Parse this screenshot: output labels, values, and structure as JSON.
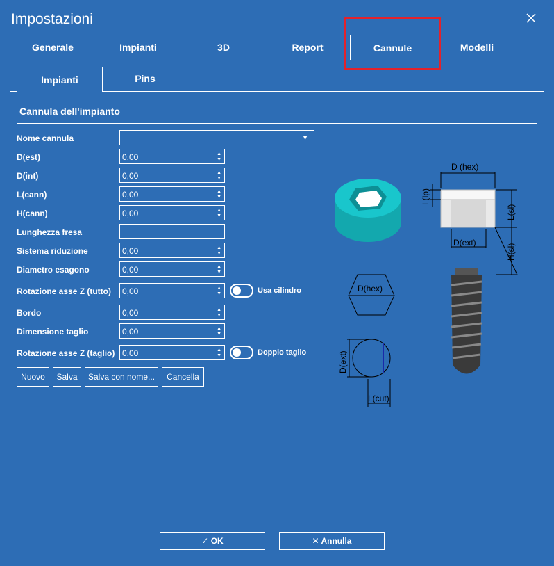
{
  "window": {
    "title": "Impostazioni"
  },
  "tabs": [
    {
      "label": "Generale"
    },
    {
      "label": "Impianti"
    },
    {
      "label": "3D"
    },
    {
      "label": "Report"
    },
    {
      "label": "Cannule"
    },
    {
      "label": "Modelli"
    }
  ],
  "subtabs": [
    {
      "label": "Impianti"
    },
    {
      "label": "Pins"
    }
  ],
  "section": {
    "title": "Cannula dell'impianto"
  },
  "form": {
    "nome_cannula": {
      "label": "Nome cannula",
      "value": ""
    },
    "d_est": {
      "label": "D(est)",
      "value": "0,00"
    },
    "d_int": {
      "label": "D(int)",
      "value": "0,00"
    },
    "l_cann": {
      "label": "L(cann)",
      "value": "0,00"
    },
    "h_cann": {
      "label": "H(cann)",
      "value": "0,00"
    },
    "lunghezza_fresa": {
      "label": "Lunghezza fresa",
      "value": ""
    },
    "sistema_riduzione": {
      "label": "Sistema riduzione",
      "value": "0,00"
    },
    "diametro_esagono": {
      "label": "Diametro esagono",
      "value": "0,00"
    },
    "rotazione_tutto": {
      "label": "Rotazione asse Z (tutto)",
      "value": "0,00"
    },
    "usa_cilindro": {
      "label": "Usa cilindro",
      "checked": false
    },
    "bordo": {
      "label": "Bordo",
      "value": "0,00"
    },
    "dimensione_taglio": {
      "label": "Dimensione taglio",
      "value": "0,00"
    },
    "rotazione_taglio": {
      "label": "Rotazione asse Z (taglio)",
      "value": "0,00"
    },
    "doppio_taglio": {
      "label": "Doppio taglio",
      "checked": false
    }
  },
  "actions": {
    "nuovo": "Nuovo",
    "salva": "Salva",
    "salva_con_nome": "Salva con nome...",
    "cancella": "Cancella"
  },
  "diagram": {
    "d_hex": "D (hex)",
    "l_lp": "L(lp)",
    "l_sl": "L(sl)",
    "d_ext": "D(ext)",
    "h_sl": "H(sl)",
    "d_hex_2": "D(hex)",
    "d_ext_2": "D(ext)",
    "l_cut": "L(cut)"
  },
  "dialog": {
    "ok": "OK",
    "cancel": "Annulla"
  },
  "colors": {
    "background": "#2d6db5",
    "highlight": "#e3222b",
    "cyan": "#16c2c8"
  }
}
